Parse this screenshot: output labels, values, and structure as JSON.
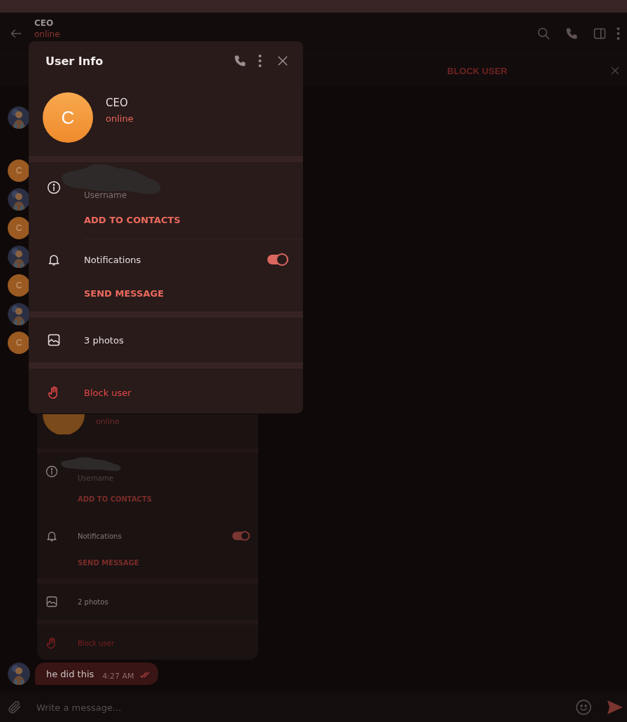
{
  "chat_header": {
    "name": "CEO",
    "status": "online"
  },
  "pinned_bar": {
    "action": "BLOCK USER"
  },
  "chat": {
    "avatars": [
      {
        "kind": "picture"
      },
      {
        "kind": "letter",
        "letter": "C"
      },
      {
        "kind": "picture"
      },
      {
        "kind": "letter",
        "letter": "C"
      },
      {
        "kind": "picture"
      },
      {
        "kind": "letter",
        "letter": "C"
      },
      {
        "kind": "picture"
      },
      {
        "kind": "letter",
        "letter": "C"
      }
    ],
    "messages": [
      {
        "kind": "screenshot",
        "screenshot": {
          "status": "online",
          "username_label": "Username",
          "add_contact": "ADD TO CONTACTS",
          "notifications_label": "Notifications",
          "notifications_on": true,
          "send_message": "SEND MESSAGE",
          "photos": "2 photos",
          "block": "Block user"
        }
      },
      {
        "kind": "text",
        "avatar": {
          "kind": "picture"
        },
        "text": "he did this",
        "time": "4:27 AM",
        "read": true
      }
    ]
  },
  "dialog": {
    "title": "User Info",
    "avatar_letter": "C",
    "name": "CEO",
    "status": "online",
    "username_label": "Username",
    "add_contact": "ADD TO CONTACTS",
    "notifications_label": "Notifications",
    "notifications_on": true,
    "send_message": "SEND MESSAGE",
    "photos": "3 photos",
    "block": "Block user"
  },
  "composer": {
    "placeholder": "Write a message..."
  }
}
